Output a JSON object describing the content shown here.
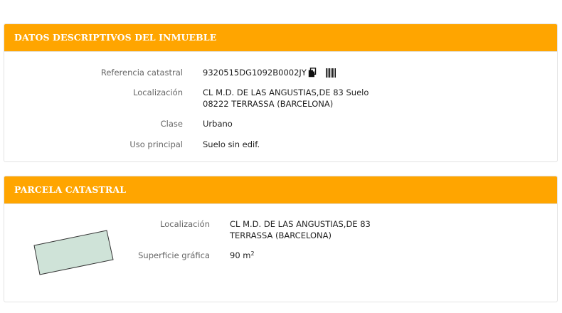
{
  "inmueble": {
    "title": "DATOS DESCRIPTIVOS DEL INMUEBLE",
    "ref_label": "Referencia catastral",
    "ref_value": "9320515DG1092B0002JY",
    "icons": [
      "copy-icon",
      "barcode-icon"
    ],
    "loc_label": "Localización",
    "loc_line1": "CL M.D. DE LAS ANGUSTIAS,DE 83 Suelo",
    "loc_line2": "08222 TERRASSA (BARCELONA)",
    "clase_label": "Clase",
    "clase_value": "Urbano",
    "uso_label": "Uso principal",
    "uso_value": "Suelo sin edif."
  },
  "parcela": {
    "title": "PARCELA CATASTRAL",
    "loc_label": "Localización",
    "loc_line1": "CL M.D. DE LAS ANGUSTIAS,DE 83",
    "loc_line2": "TERRASSA (BARCELONA)",
    "sup_label": "Superficie gráfica",
    "sup_value": "90 m",
    "sup_unit_exp": "2"
  },
  "colors": {
    "header_bg": "#ffa500",
    "header_text": "#ffffff",
    "parcel_fill": "#cfe3d8",
    "parcel_stroke": "#333333"
  }
}
